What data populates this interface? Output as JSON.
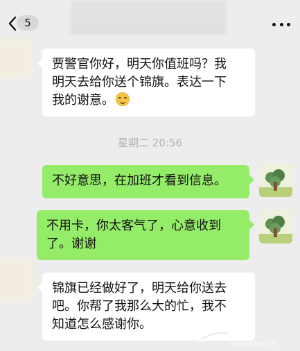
{
  "header": {
    "unread_count": "5",
    "back_icon": "chevron-left-icon",
    "more_icon": "more-dots-icon"
  },
  "messages": [
    {
      "side": "left",
      "text_lines": [
        "贾警官你好，明天你值班吗？我",
        "明天去给你送个锦旗。表达一下",
        "我的谢意。"
      ],
      "emoji": "smile-emoji"
    },
    {
      "side": "right",
      "text_lines": [
        "不好意思，在加班才看到信息。"
      ]
    },
    {
      "side": "right",
      "text_lines": [
        "不用卡，你太客气了，心意收到",
        "了。谢谢"
      ]
    },
    {
      "side": "left",
      "text_lines": [
        "锦旗已经做好了，明天给你送去",
        "吧。你帮了我那么大的忙，我不",
        "知道怎么感谢你。"
      ]
    }
  ],
  "timestamp": "星期二 20:56",
  "watermark_text": "论坛 www.la-bbs.net"
}
